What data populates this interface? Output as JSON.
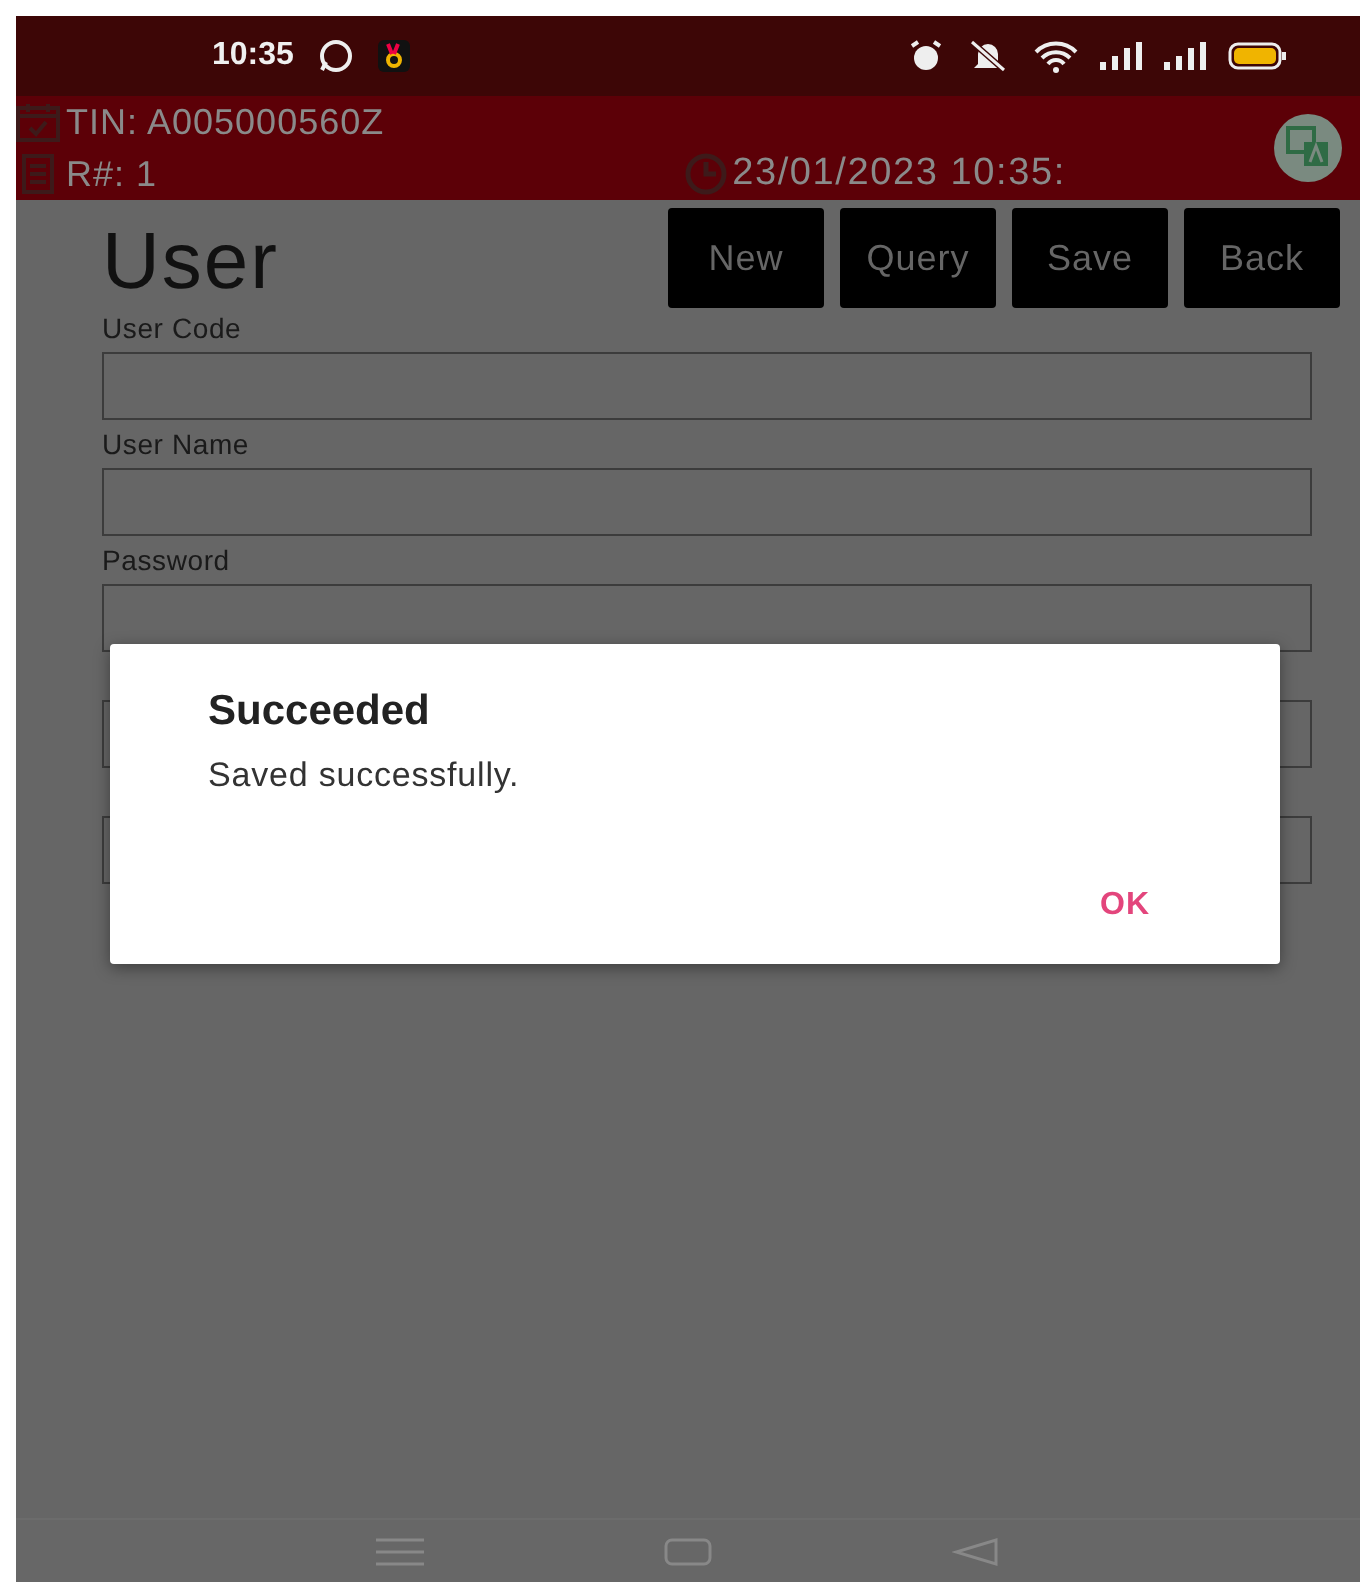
{
  "status_bar": {
    "time": "10:35"
  },
  "header": {
    "tin": "TIN: A005000560Z",
    "receipt": "R#: 1",
    "datetime": "23/01/2023 10:35:"
  },
  "page": {
    "title": "User",
    "buttons": [
      "New",
      "Query",
      "Save",
      "Back"
    ]
  },
  "fields": [
    {
      "kind": "labeled",
      "label": "User Code"
    },
    {
      "kind": "labeled",
      "label": "User Name"
    },
    {
      "kind": "labeled",
      "label": "Password"
    },
    {
      "kind": "covered"
    },
    {
      "kind": "covered"
    }
  ],
  "dialog": {
    "title": "Succeeded",
    "message": "Saved successfully.",
    "button": "OK"
  }
}
